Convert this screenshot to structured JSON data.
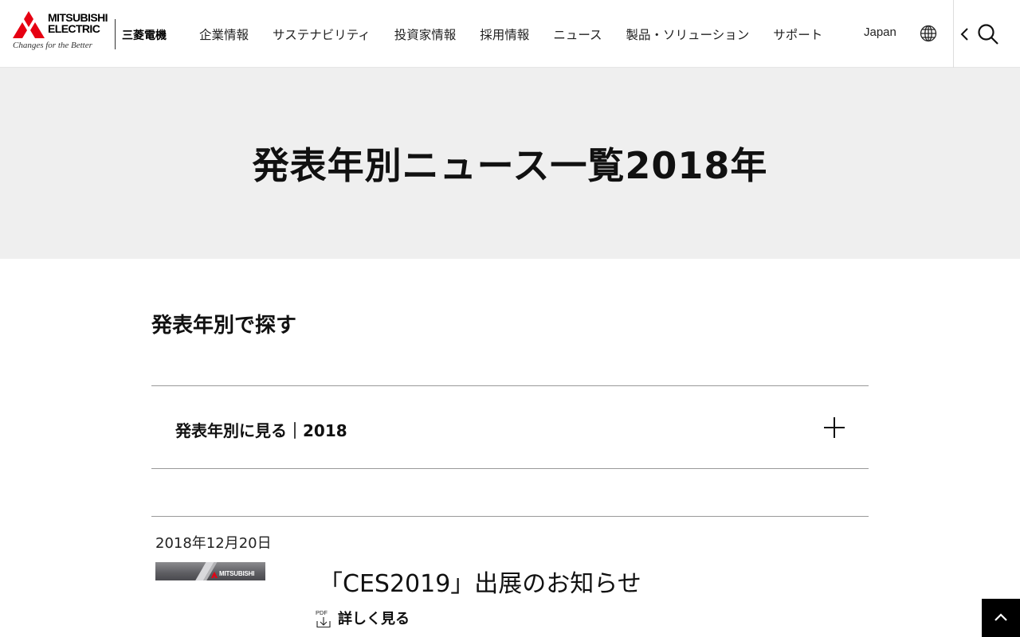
{
  "header": {
    "brand": "MITSUBISHI ELECTRIC",
    "tagline": "Changes for the Better",
    "brand_jp": "三菱電機",
    "nav": [
      "企業情報",
      "サステナビリティ",
      "投資家情報",
      "採用情報",
      "ニュース",
      "製品・ソリューション",
      "サポート"
    ],
    "region": "Japan",
    "icons": {
      "region": "globe-icon",
      "back": "chevron-left-icon",
      "search": "search-icon"
    }
  },
  "hero": {
    "title": "発表年別ニュース一覧2018年"
  },
  "filter": {
    "heading": "発表年別で探す",
    "accordion_label": "発表年別に見る｜2018",
    "accordion_icon": "plus-icon"
  },
  "news": [
    {
      "date": "2018年12月20日",
      "thumb_text": "MITSUBISHI",
      "title": "「CES2019」出展のお知らせ",
      "pdf_label": "PDF",
      "more": "詳しく見る"
    }
  ],
  "pagetop": {
    "icon": "chevron-up-icon"
  },
  "colors": {
    "brand_red": "#e60012",
    "hero_bg": "#efefef",
    "text": "#111111"
  }
}
